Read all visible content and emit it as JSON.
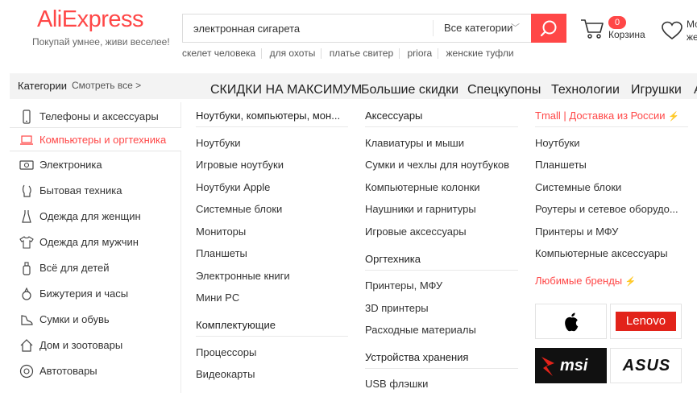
{
  "header": {
    "logo_text": "AliExpress",
    "tagline": "Покупай умнее, живи веселее!",
    "search_value": "электронная сигарета",
    "category_select": "Все категории",
    "hot_words": [
      "скелет человека",
      "для охоты",
      "платье свитер",
      "priora",
      "женские туфли"
    ],
    "cart_count": "0",
    "cart_label": "Корзина",
    "wish_label": "Мои желания"
  },
  "categories_bar": {
    "title": "Категории",
    "see_all": "Смотреть все >"
  },
  "promo_nav": [
    "СКИДКИ НА МАКСИМУМ",
    "Большие скидки",
    "Спецкупоны",
    "Технологии",
    "Игрушки",
    "А"
  ],
  "sidebar": [
    {
      "label": "Телефоны и аксессуары",
      "icon": "phone-icon"
    },
    {
      "label": "Компьютеры и оргтехника",
      "icon": "laptop-icon",
      "active": true
    },
    {
      "label": "Электроника",
      "icon": "tv-icon"
    },
    {
      "label": "Бытовая техника",
      "icon": "appliance-icon"
    },
    {
      "label": "Одежда для женщин",
      "icon": "dress-icon"
    },
    {
      "label": "Одежда для мужчин",
      "icon": "shirt-icon"
    },
    {
      "label": "Всё для детей",
      "icon": "baby-icon"
    },
    {
      "label": "Бижутерия и часы",
      "icon": "ring-icon"
    },
    {
      "label": "Сумки и обувь",
      "icon": "shoe-icon"
    },
    {
      "label": "Дом и зоотовары",
      "icon": "home-icon"
    },
    {
      "label": "Автотовары",
      "icon": "wheel-icon"
    }
  ],
  "menu": {
    "col1": {
      "head1": "Ноутбуки, компьютеры, мон...",
      "links1": [
        "Ноутбуки",
        "Игровые ноутбуки",
        "Ноутбуки Apple",
        " Системные блоки",
        "Мониторы",
        "Планшеты",
        "Электронные книги",
        "Мини PC"
      ],
      "head2": "Комплектующие",
      "links2": [
        "Процессоры",
        "Видеокарты"
      ]
    },
    "col2": {
      "head1": "Аксессуары",
      "links1": [
        "Клавиатуры и мыши",
        "Сумки и чехлы для ноутбуков",
        "Компьютерные колонки",
        "Наушники и гарнитуры",
        "Игровые аксессуары"
      ],
      "head2": "Оргтехника",
      "links2": [
        "Принтеры, МФУ",
        "3D принтеры",
        "Расходные материалы"
      ],
      "head3": "Устройства хранения",
      "links3": [
        "USB флэшки"
      ]
    },
    "col3": {
      "head1": "Tmall | Доставка из России",
      "links1": [
        "Ноутбуки",
        "Планшеты",
        "Системные блоки",
        "Роутеры и сетевое оборудо...",
        "Принтеры и МФУ",
        "Компьютерные аксессуары"
      ],
      "head2": "Любимые бренды",
      "brands": [
        "apple-logo",
        "Lenovo",
        "msi",
        "ASUS"
      ]
    }
  },
  "colors": {
    "accent": "#ff4747",
    "bolt": "#f5b000"
  }
}
